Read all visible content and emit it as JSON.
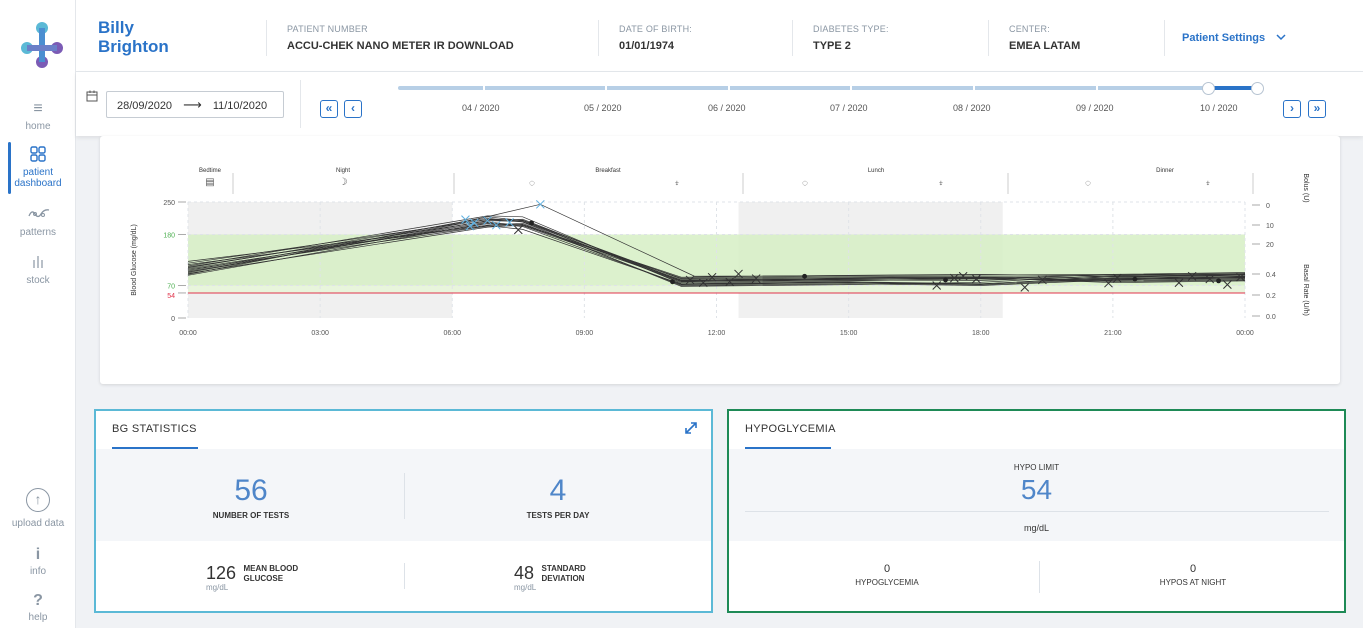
{
  "sidebar": {
    "items": [
      {
        "label": "home",
        "icon": "list-icon"
      },
      {
        "label": "patient dashboard",
        "line1": "patient",
        "line2": "dashboard",
        "icon": "grid-icon"
      },
      {
        "label": "patterns",
        "icon": "patterns-icon"
      },
      {
        "label": "stock",
        "icon": "stock-icon"
      }
    ],
    "bottom": [
      {
        "label": "upload data",
        "icon": "upload-icon"
      },
      {
        "label": "info",
        "glyph": "i",
        "icon": "info-icon"
      },
      {
        "label": "help",
        "glyph": "?",
        "icon": "help-icon"
      }
    ]
  },
  "header": {
    "first_name": "Billy",
    "last_name": "Brighton",
    "fields": [
      {
        "label": "PATIENT NUMBER",
        "value": "ACCU-CHEK NANO METER IR DOWNLOAD"
      },
      {
        "label": "DATE OF BIRTH:",
        "value": "01/01/1974"
      },
      {
        "label": "DIABETES TYPE:",
        "value": "TYPE 2"
      },
      {
        "label": "CENTER:",
        "value": "EMEA LATAM"
      }
    ],
    "settings_label": "Patient Settings"
  },
  "datebar": {
    "from": "28/09/2020",
    "arrow": "⟶",
    "to": "11/10/2020",
    "months": [
      "04 / 2020",
      "05 / 2020",
      "06 / 2020",
      "07 / 2020",
      "08 / 2020",
      "09 / 2020",
      "10 / 2020"
    ],
    "first_btn": "«",
    "prev_btn": "‹",
    "next_btn": "›",
    "last_btn": "»"
  },
  "chart": {
    "y_axis_label": "Blood Glucose (mg/dL)",
    "y2_top_label": "Bolus (U)",
    "y2_bottom_label": "Basal Rate (U/h)",
    "y_ticks": [
      "250",
      "180",
      "70",
      "54",
      "0"
    ],
    "y2_top_ticks": [
      "0",
      "10",
      "20"
    ],
    "y2_bottom_ticks": [
      "0.4",
      "0.2",
      "0.0"
    ],
    "x_ticks": [
      "00:00",
      "03:00",
      "06:00",
      "09:00",
      "12:00",
      "15:00",
      "18:00",
      "21:00",
      "00:00"
    ],
    "periods": [
      "Bedtime",
      "Night",
      "Breakfast",
      "Lunch",
      "Dinner"
    ],
    "colors": {
      "target_band": "#d6efc4",
      "hypo_line": "#e0344b",
      "pre_meal": "#f0f0f0",
      "line": "#333333",
      "cross_light": "#5fb0e0"
    }
  },
  "bg_stats": {
    "title": "BG STATISTICS",
    "tests": "56",
    "tests_label": "NUMBER OF TESTS",
    "per_day": "4",
    "per_day_label": "TESTS PER DAY",
    "mean": "126",
    "mean_unit": "mg/dL",
    "mean_label_1": "MEAN BLOOD",
    "mean_label_2": "GLUCOSE",
    "sd": "48",
    "sd_unit": "mg/dL",
    "sd_label_1": "STANDARD",
    "sd_label_2": "DEVIATION"
  },
  "hypo": {
    "title": "HYPOGLYCEMIA",
    "limit_label": "HYPO LIMIT",
    "limit": "54",
    "unit": "mg/dL",
    "hypoglycemia": "0",
    "hypoglycemia_label": "HYPOGLYCEMIA",
    "night": "0",
    "night_label": "HYPOS AT NIGHT"
  }
}
